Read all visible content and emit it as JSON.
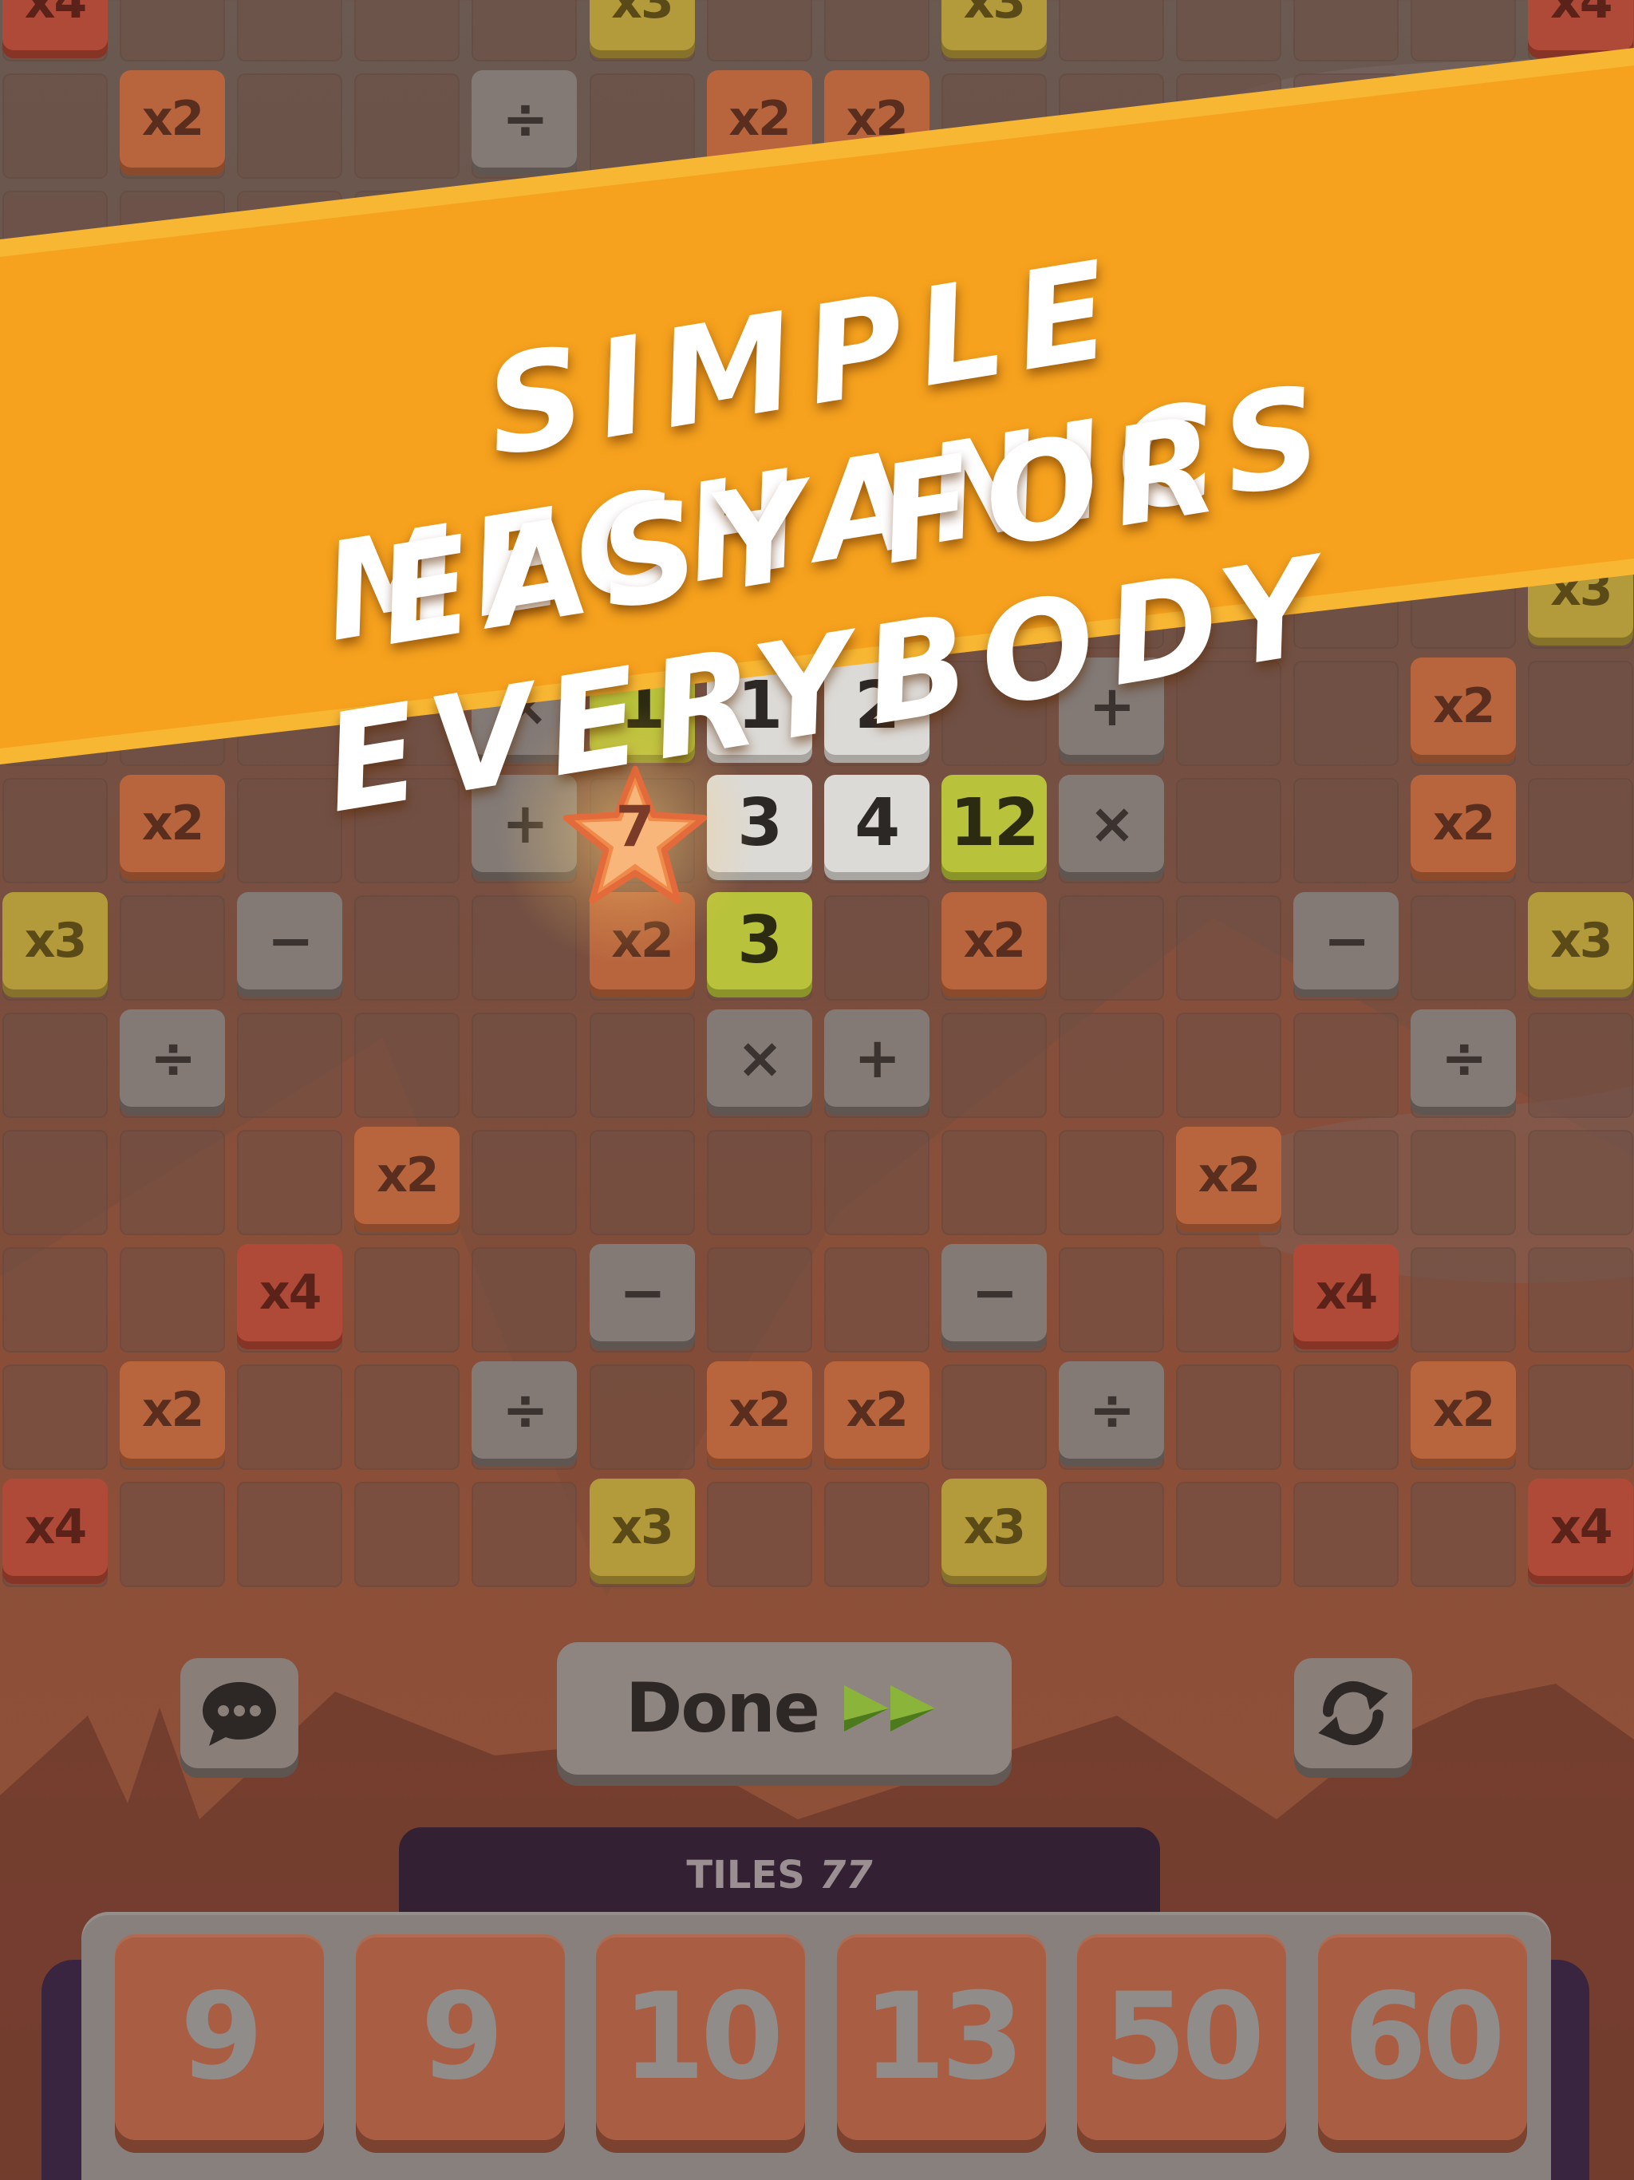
{
  "banner": {
    "line1": "SIMPLE MECHANICS",
    "line2": "EASY FOR EVERYBODY",
    "color": "#f6a623"
  },
  "board": {
    "multiplier_tiles": [
      {
        "label": "x4",
        "kind": "x4",
        "col": 0,
        "row": 0
      },
      {
        "label": "x3",
        "kind": "x3",
        "col": 5,
        "row": 0
      },
      {
        "label": "x3",
        "kind": "x3",
        "col": 8,
        "row": 0
      },
      {
        "label": "x4",
        "kind": "x4",
        "col": 13,
        "row": 0
      },
      {
        "label": "x2",
        "kind": "x2",
        "col": 1,
        "row": 1
      },
      {
        "label": "x2",
        "kind": "x2",
        "col": 6,
        "row": 1
      },
      {
        "label": "x2",
        "kind": "x2",
        "col": 7,
        "row": 1
      },
      {
        "label": "x3",
        "kind": "x3",
        "col": 13,
        "row": 5
      },
      {
        "label": "x2",
        "kind": "x2",
        "col": 12,
        "row": 6
      },
      {
        "label": "x2",
        "kind": "x2",
        "col": 1,
        "row": 7
      },
      {
        "label": "x2",
        "kind": "x2",
        "col": 12,
        "row": 7
      },
      {
        "label": "x3",
        "kind": "x3",
        "col": 0,
        "row": 8
      },
      {
        "label": "x2",
        "kind": "x2",
        "col": 5,
        "row": 8
      },
      {
        "label": "x2",
        "kind": "x2",
        "col": 8,
        "row": 8
      },
      {
        "label": "x3",
        "kind": "x3",
        "col": 13,
        "row": 8
      },
      {
        "label": "x2",
        "kind": "x2",
        "col": 3,
        "row": 10
      },
      {
        "label": "x2",
        "kind": "x2",
        "col": 10,
        "row": 10
      },
      {
        "label": "x4",
        "kind": "x4",
        "col": 2,
        "row": 11
      },
      {
        "label": "x4",
        "kind": "x4",
        "col": 11,
        "row": 11
      },
      {
        "label": "x2",
        "kind": "x2",
        "col": 1,
        "row": 12
      },
      {
        "label": "x2",
        "kind": "x2",
        "col": 6,
        "row": 12
      },
      {
        "label": "x2",
        "kind": "x2",
        "col": 7,
        "row": 12
      },
      {
        "label": "x2",
        "kind": "x2",
        "col": 12,
        "row": 12
      },
      {
        "label": "x4",
        "kind": "x4",
        "col": 0,
        "row": 13
      },
      {
        "label": "x3",
        "kind": "x3",
        "col": 5,
        "row": 13
      },
      {
        "label": "x3",
        "kind": "x3",
        "col": 8,
        "row": 13
      },
      {
        "label": "x4",
        "kind": "x4",
        "col": 13,
        "row": 13
      }
    ],
    "operator_tiles": [
      {
        "label": "÷",
        "col": 4,
        "row": 1
      },
      {
        "label": "×",
        "col": 4,
        "row": 6
      },
      {
        "label": "+",
        "col": 9,
        "row": 6
      },
      {
        "label": "+",
        "col": 4,
        "row": 7
      },
      {
        "label": "×",
        "col": 9,
        "row": 7
      },
      {
        "label": "−",
        "col": 2,
        "row": 8
      },
      {
        "label": "−",
        "col": 11,
        "row": 8
      },
      {
        "label": "÷",
        "col": 1,
        "row": 9
      },
      {
        "label": "×",
        "col": 6,
        "row": 9
      },
      {
        "label": "+",
        "col": 7,
        "row": 9
      },
      {
        "label": "÷",
        "col": 12,
        "row": 9
      },
      {
        "label": "−",
        "col": 5,
        "row": 11
      },
      {
        "label": "−",
        "col": 8,
        "row": 11
      },
      {
        "label": "÷",
        "col": 4,
        "row": 12
      },
      {
        "label": "÷",
        "col": 9,
        "row": 12
      }
    ],
    "number_tiles": [
      {
        "label": "1",
        "kind": "green",
        "col": 5,
        "row": 6
      },
      {
        "label": "1",
        "kind": "white",
        "col": 6,
        "row": 6
      },
      {
        "label": "2",
        "kind": "white",
        "col": 7,
        "row": 6
      },
      {
        "label": "3",
        "kind": "white",
        "col": 6,
        "row": 7
      },
      {
        "label": "4",
        "kind": "white",
        "col": 7,
        "row": 7
      },
      {
        "label": "12",
        "kind": "green",
        "col": 8,
        "row": 7
      },
      {
        "label": "3",
        "kind": "green",
        "col": 6,
        "row": 8
      }
    ],
    "star_tile": {
      "label": "7",
      "col": 5,
      "row": 7
    }
  },
  "controls": {
    "chat_icon": "chat-bubble-icon",
    "done_label": "Done",
    "done_icon": "fast-forward-icon",
    "swap_icon": "refresh-icon"
  },
  "tiles_panel": {
    "label": "TILES",
    "count": "77"
  },
  "rack": [
    "9",
    "9",
    "10",
    "13",
    "50",
    "60"
  ]
}
